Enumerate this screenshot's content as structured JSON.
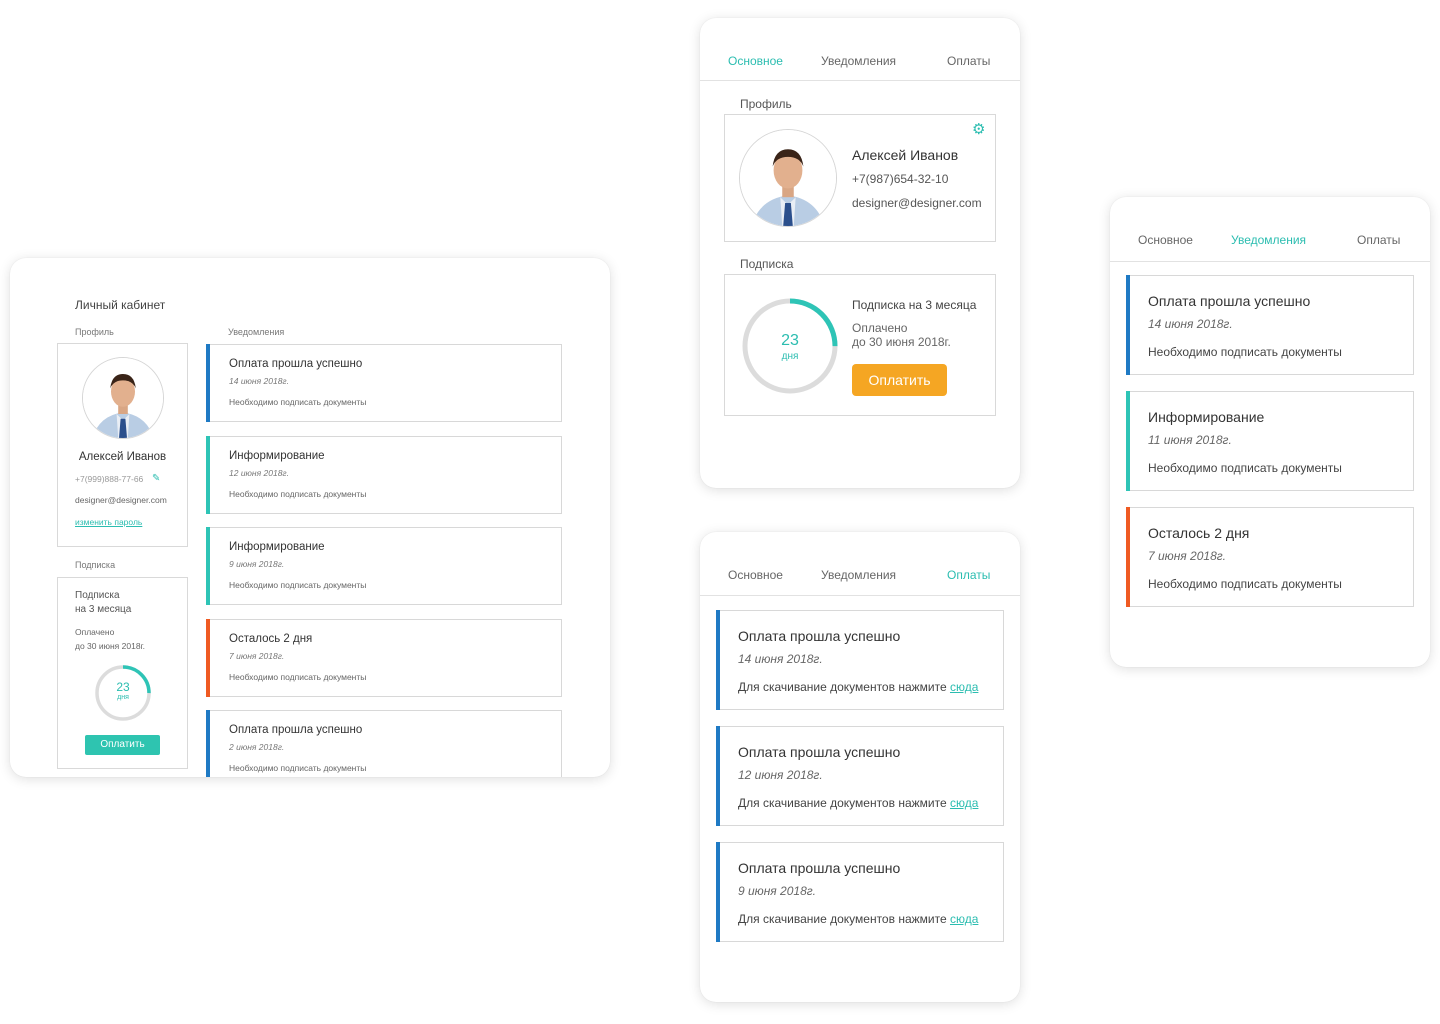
{
  "desktop": {
    "title": "Личный кабинет",
    "profile_label": "Профиль",
    "notifications_label": "Уведомления",
    "user": {
      "name": "Алексей Иванов",
      "phone": "+7(999)888-77-66",
      "email": "designer@designer.com",
      "change_password": "изменить пароль"
    },
    "subscription_label": "Подписка",
    "subscription": {
      "title_line1": "Подписка",
      "title_line2": "на 3 месяца",
      "paid_line1": "Оплачено",
      "paid_line2": "до 30 июня 2018г.",
      "days_value": "23",
      "days_unit": "дня",
      "ring_fraction": 0.25,
      "pay_button": "Оплатить"
    },
    "notifications": [
      {
        "title": "Оплата прошла успешно",
        "date": "14 июня 2018г.",
        "text": "Необходимо подписать документы",
        "color": "#1f7ac4"
      },
      {
        "title": "Информирование",
        "date": "12 июня 2018г.",
        "text": "Необходимо подписать документы",
        "color": "#2ec4b6"
      },
      {
        "title": "Информирование",
        "date": "9 июня 2018г.",
        "text": "Необходимо подписать документы",
        "color": "#2ec4b6"
      },
      {
        "title": "Осталось 2 дня",
        "date": "7 июня 2018г.",
        "text": "Необходимо подписать документы",
        "color": "#ef5a22"
      },
      {
        "title": "Оплата прошла успешно",
        "date": "2 июня 2018г.",
        "text": "Необходимо подписать документы",
        "color": "#1f7ac4"
      }
    ]
  },
  "mobile_main": {
    "tabs": [
      "Основное",
      "Уведомления",
      "Оплаты"
    ],
    "active_tab": "Основное",
    "profile_label": "Профиль",
    "user": {
      "name": "Алексей Иванов",
      "phone": "+7(987)654-32-10",
      "email": "designer@designer.com"
    },
    "subscription_label": "Подписка",
    "subscription": {
      "title": "Подписка на 3 месяца",
      "paid_line1": "Оплачено",
      "paid_line2": "до 30 июня 2018г.",
      "days_value": "23",
      "days_unit": "дня",
      "ring_fraction": 0.25,
      "pay_button": "Оплатить"
    }
  },
  "mobile_payments": {
    "tabs": [
      "Основное",
      "Уведомления",
      "Оплаты"
    ],
    "active_tab": "Оплаты",
    "items": [
      {
        "title": "Оплата прошла успешно",
        "date": "14 июня 2018г.",
        "text": "Для скачивание документов нажмите",
        "link": "сюда",
        "color": "#1f7ac4"
      },
      {
        "title": "Оплата прошла успешно",
        "date": "12 июня 2018г.",
        "text": "Для скачивание документов нажмите",
        "link": "сюда",
        "color": "#1f7ac4"
      },
      {
        "title": "Оплата прошла успешно",
        "date": "9 июня 2018г.",
        "text": "Для скачивание документов нажмите",
        "link": "сюда",
        "color": "#1f7ac4"
      }
    ]
  },
  "mobile_notifications": {
    "tabs": [
      "Основное",
      "Уведомления",
      "Оплаты"
    ],
    "active_tab": "Уведомления",
    "items": [
      {
        "title": "Оплата прошла успешно",
        "date": "14 июня 2018г.",
        "text": "Необходимо подписать документы",
        "color": "#1f7ac4"
      },
      {
        "title": "Информирование",
        "date": "11 июня 2018г.",
        "text": "Необходимо подписать документы",
        "color": "#2ec4b6"
      },
      {
        "title": "Осталось 2 дня",
        "date": "7 июня 2018г.",
        "text": "Необходимо подписать документы",
        "color": "#ef5a22"
      }
    ]
  },
  "colors": {
    "accent": "#2bbdb0",
    "button_teal": "#2ec4b0",
    "button_orange": "#f5a623",
    "blue": "#1f7ac4",
    "teal": "#2ec4b6",
    "orange": "#ef5a22"
  },
  "icons": {
    "edit": "pencil-icon",
    "settings": "gear-icon",
    "avatar": "user-avatar"
  }
}
